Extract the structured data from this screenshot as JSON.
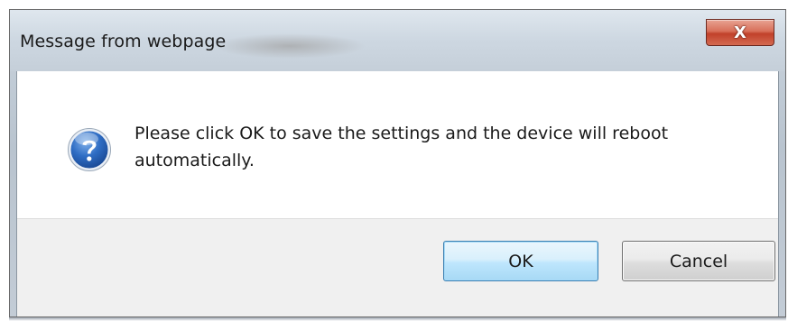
{
  "dialog": {
    "title": "Message from webpage",
    "close_symbol": "X",
    "icon": "question-icon",
    "message": "Please click OK to save the settings and the device will reboot automatically.",
    "ok_label": "OK",
    "cancel_label": "Cancel"
  }
}
